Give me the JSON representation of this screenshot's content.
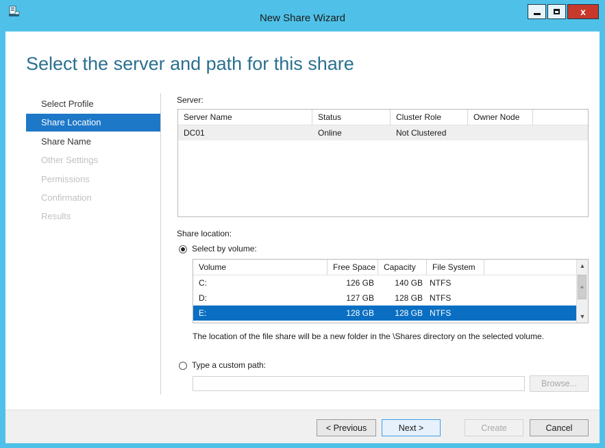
{
  "window": {
    "title": "New Share Wizard",
    "close_glyph": "x"
  },
  "heading": "Select the server and path for this share",
  "nav": {
    "items": [
      {
        "label": "Select Profile",
        "state": "normal"
      },
      {
        "label": "Share Location",
        "state": "active"
      },
      {
        "label": "Share Name",
        "state": "normal"
      },
      {
        "label": "Other Settings",
        "state": "disabled"
      },
      {
        "label": "Permissions",
        "state": "disabled"
      },
      {
        "label": "Confirmation",
        "state": "disabled"
      },
      {
        "label": "Results",
        "state": "disabled"
      }
    ]
  },
  "server": {
    "label": "Server:",
    "columns": [
      "Server Name",
      "Status",
      "Cluster Role",
      "Owner Node"
    ],
    "rows": [
      {
        "name": "DC01",
        "status": "Online",
        "cluster_role": "Not Clustered",
        "owner_node": ""
      }
    ]
  },
  "share_location": {
    "label": "Share location:",
    "by_volume_label": "Select by volume:",
    "by_volume_selected": true,
    "volume_columns": [
      "Volume",
      "Free Space",
      "Capacity",
      "File System"
    ],
    "volumes": [
      {
        "volume": "C:",
        "free": "126 GB",
        "capacity": "140 GB",
        "fs": "NTFS",
        "selected": false
      },
      {
        "volume": "D:",
        "free": "127 GB",
        "capacity": "128 GB",
        "fs": "NTFS",
        "selected": false
      },
      {
        "volume": "E:",
        "free": "128 GB",
        "capacity": "128 GB",
        "fs": "NTFS",
        "selected": true
      }
    ],
    "info_text": "The location of the file share will be a new folder in the \\Shares directory on the selected volume.",
    "custom_path_label": "Type a custom path:",
    "custom_path_selected": false,
    "custom_path_value": "",
    "browse_label": "Browse..."
  },
  "footer": {
    "previous": "< Previous",
    "next": "Next >",
    "create": "Create",
    "cancel": "Cancel"
  },
  "colors": {
    "titlebar": "#4fc1e8",
    "accent": "#1e78c8",
    "selection": "#0a6fc2",
    "close": "#c7392b"
  }
}
